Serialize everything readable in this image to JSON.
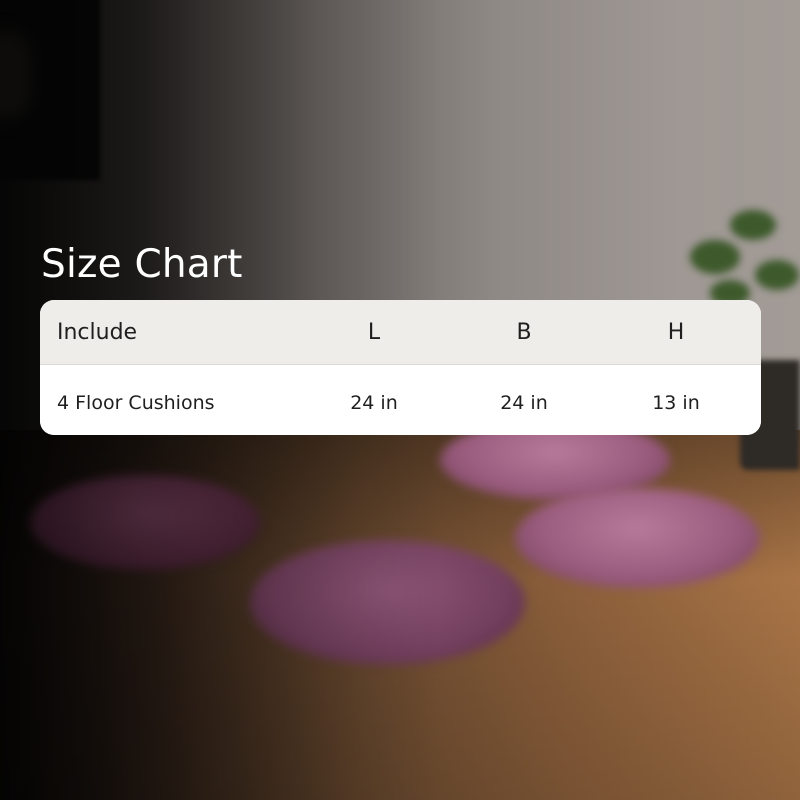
{
  "title": "Size Chart",
  "table": {
    "columns": [
      "Include",
      "L",
      "B",
      "H"
    ],
    "rows": [
      [
        "4 Floor Cushions",
        "24 in",
        "24 in",
        "13 in"
      ]
    ]
  },
  "colors": {
    "card_header_bg": "#efede9",
    "card_body_bg": "#ffffff",
    "title_text": "#ffffff",
    "cell_text": "#1f1f1f",
    "cushion_pink": "#9b5d7f"
  }
}
